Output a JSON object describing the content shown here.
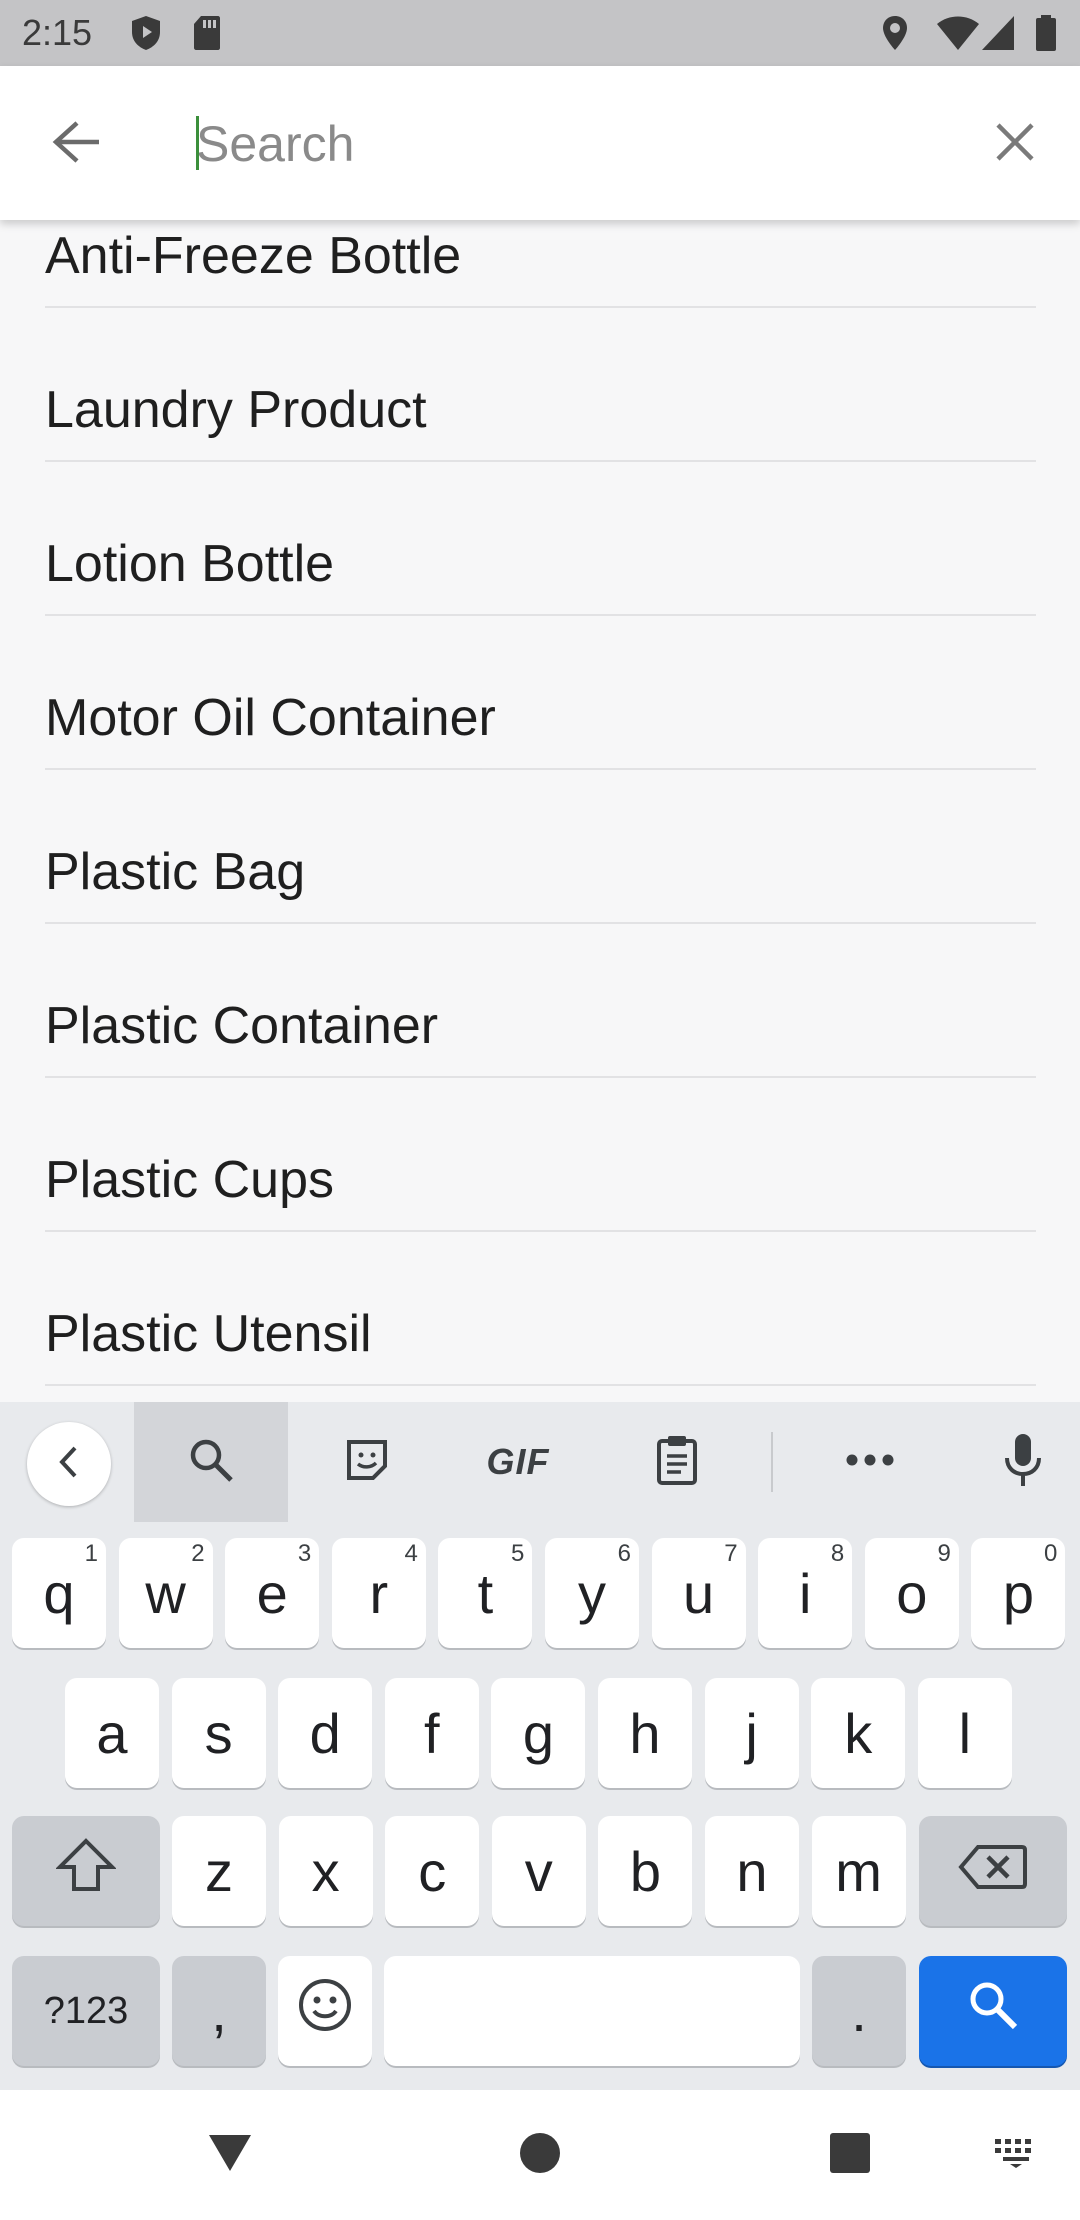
{
  "status_bar": {
    "time": "2:15"
  },
  "search": {
    "placeholder": "Search",
    "value": ""
  },
  "results": [
    "Anti-Freeze Bottle",
    "Laundry Product",
    "Lotion Bottle",
    "Motor Oil Container",
    "Plastic Bag",
    "Plastic Container",
    "Plastic Cups",
    "Plastic Utensil"
  ],
  "keyboard": {
    "toolbar": {
      "gif_label": "GIF"
    },
    "row1": [
      {
        "key": "q",
        "hint": "1"
      },
      {
        "key": "w",
        "hint": "2"
      },
      {
        "key": "e",
        "hint": "3"
      },
      {
        "key": "r",
        "hint": "4"
      },
      {
        "key": "t",
        "hint": "5"
      },
      {
        "key": "y",
        "hint": "6"
      },
      {
        "key": "u",
        "hint": "7"
      },
      {
        "key": "i",
        "hint": "8"
      },
      {
        "key": "o",
        "hint": "9"
      },
      {
        "key": "p",
        "hint": "0"
      }
    ],
    "row2": [
      "a",
      "s",
      "d",
      "f",
      "g",
      "h",
      "j",
      "k",
      "l"
    ],
    "row3": [
      "z",
      "x",
      "c",
      "v",
      "b",
      "n",
      "m"
    ],
    "symbols_label": "?123",
    "comma": ",",
    "period": "."
  },
  "colors": {
    "accent": "#1a73e8",
    "caret": "#3b8f3b"
  }
}
